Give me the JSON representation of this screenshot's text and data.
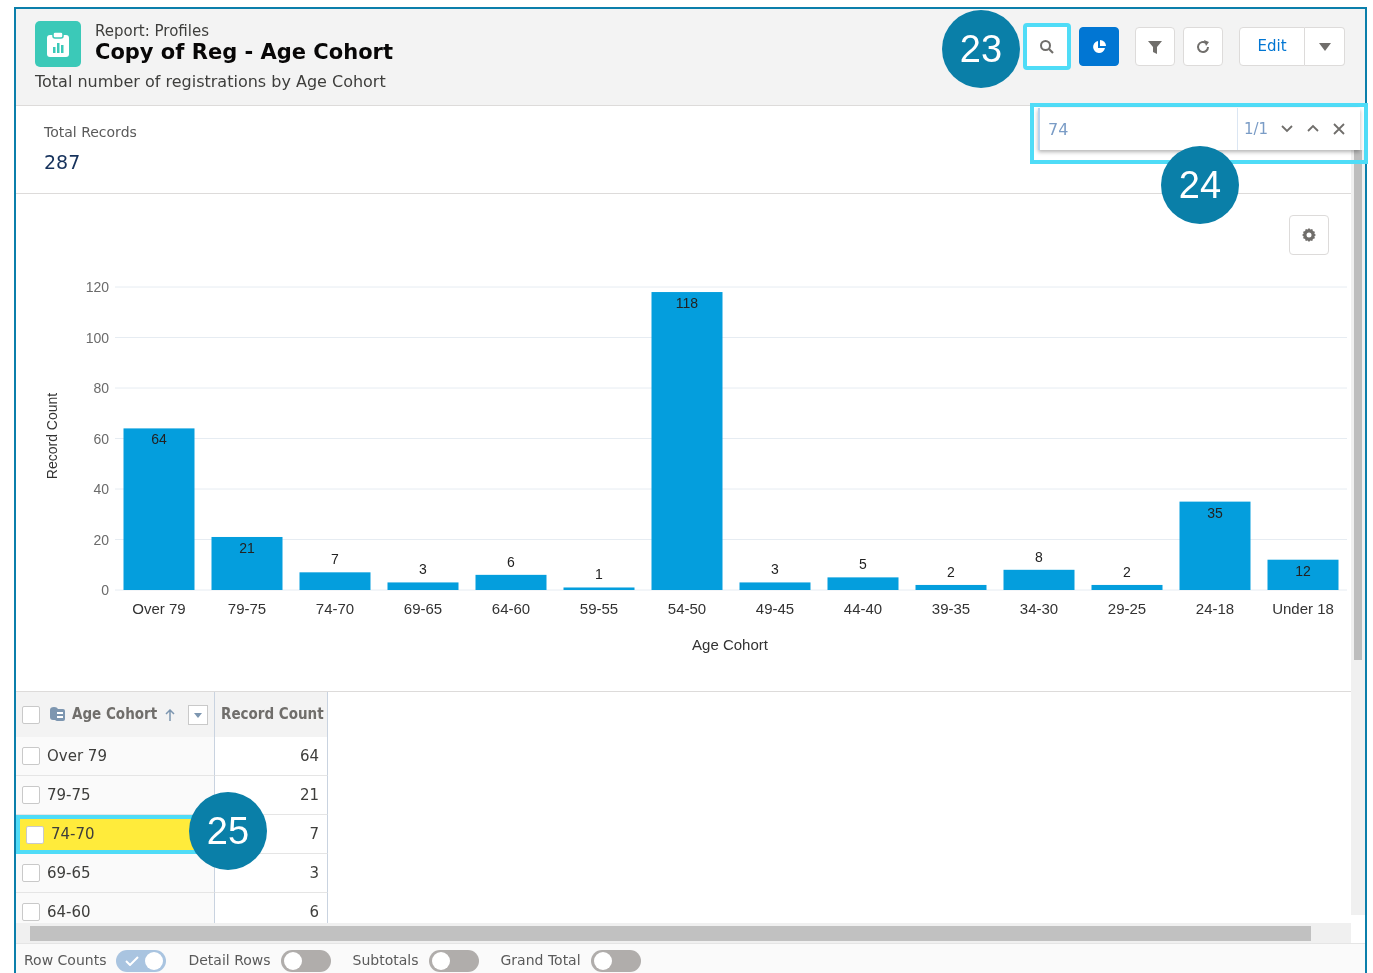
{
  "header": {
    "object_label": "Report: Profiles",
    "title": "Copy of Reg - Age Cohort",
    "description": "Total number of registrations by Age Cohort"
  },
  "toolbar": [
    {
      "kind": "search",
      "selected": false,
      "highlighted": true
    },
    {
      "kind": "chart",
      "selected": true,
      "highlighted": false
    },
    {
      "kind": "filter",
      "selected": false,
      "highlighted": false
    },
    {
      "kind": "refresh",
      "selected": false,
      "highlighted": false
    },
    {
      "kind": "edit",
      "label": "Edit",
      "selected": false,
      "highlighted": false
    },
    {
      "kind": "menu",
      "selected": false,
      "highlighted": false
    }
  ],
  "find_bar": {
    "value": "74",
    "match_count": "1/1",
    "highlighted": true
  },
  "summary": {
    "label": "Total Records",
    "value": "287"
  },
  "chart": {
    "chart_data": {
      "type": "bar",
      "xlabel": "Age Cohort",
      "ylabel": "Record Count",
      "categories": [
        "Over 79",
        "79-75",
        "74-70",
        "69-65",
        "64-60",
        "59-55",
        "54-50",
        "49-45",
        "44-40",
        "39-35",
        "34-30",
        "29-25",
        "24-18",
        "Under 18"
      ],
      "values": [
        64,
        21,
        7,
        3,
        6,
        1,
        118,
        3,
        5,
        2,
        8,
        2,
        35,
        12
      ],
      "ylim": [
        0,
        120
      ],
      "yticks": [
        0,
        20,
        40,
        60,
        80,
        100,
        120
      ],
      "data_labels": true,
      "grid": true
    }
  },
  "table": {
    "columns": [
      "Age Cohort",
      "Record Count"
    ],
    "select_all_checked": false,
    "rows": [
      {
        "label": "Over 79",
        "count": "64",
        "checked": false,
        "search_match": false,
        "highlighted": false
      },
      {
        "label": "79-75",
        "count": "21",
        "checked": false,
        "search_match": false,
        "highlighted": false
      },
      {
        "label": "74-70",
        "count": "7",
        "checked": false,
        "search_match": true,
        "highlighted": true
      },
      {
        "label": "69-65",
        "count": "3",
        "checked": false,
        "search_match": false,
        "highlighted": false
      },
      {
        "label": "64-60",
        "count": "6",
        "checked": false,
        "search_match": false,
        "highlighted": false
      }
    ]
  },
  "footer_toggles": [
    {
      "label": "Row Counts",
      "on": true
    },
    {
      "label": "Detail Rows",
      "on": false
    },
    {
      "label": "Subtotals",
      "on": false
    },
    {
      "label": "Grand Total",
      "on": false
    }
  ],
  "callouts": [
    "23",
    "24",
    "25"
  ]
}
